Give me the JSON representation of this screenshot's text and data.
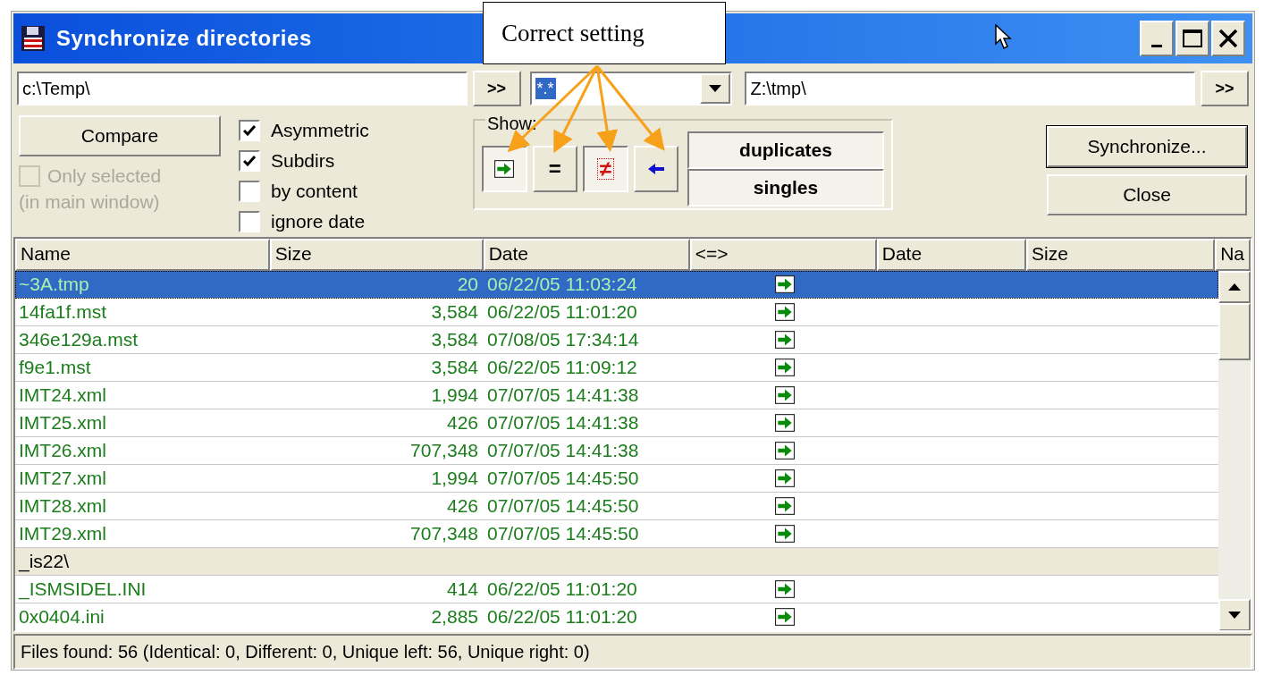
{
  "callout": {
    "text": "Correct setting"
  },
  "window": {
    "title": "Synchronize directories"
  },
  "paths": {
    "left": "c:\\Temp\\",
    "left_button": ">>",
    "filter": "*.*",
    "right": "Z:\\tmp\\",
    "right_button": ">>"
  },
  "compare_button": "Compare",
  "only_selected": {
    "label": "Only selected",
    "note": "(in main window)",
    "checked": false,
    "disabled": true
  },
  "options": [
    {
      "label": "Asymmetric",
      "checked": true
    },
    {
      "label": "Subdirs",
      "checked": true
    },
    {
      "label": "by content",
      "checked": false
    },
    {
      "label": "ignore date",
      "checked": false
    }
  ],
  "show": {
    "label": "Show:",
    "buttons": [
      {
        "kind": "right",
        "selected": true
      },
      {
        "kind": "equal",
        "label": "=",
        "selected": false
      },
      {
        "kind": "different",
        "label": "≠",
        "selected": true
      },
      {
        "kind": "left",
        "selected": false
      }
    ],
    "filters": [
      {
        "label": "duplicates",
        "selected": true
      },
      {
        "label": "singles",
        "selected": true
      }
    ]
  },
  "buttons": [
    "Synchronize...",
    "Close"
  ],
  "table": {
    "columns": [
      "Name",
      "Size",
      "Date",
      "<=>",
      "Date",
      "Size",
      "Na"
    ],
    "rows": [
      {
        "kind": "file",
        "name": "~3A.tmp",
        "size": "20",
        "date": "06/22/05 11:03:24",
        "copy_to_right": true,
        "selected": true
      },
      {
        "kind": "file",
        "name": "14fa1f.mst",
        "size": "3,584",
        "date": "06/22/05 11:01:20",
        "copy_to_right": true,
        "selected": false
      },
      {
        "kind": "file",
        "name": "346e129a.mst",
        "size": "3,584",
        "date": "07/08/05 17:34:14",
        "copy_to_right": true,
        "selected": false
      },
      {
        "kind": "file",
        "name": "f9e1.mst",
        "size": "3,584",
        "date": "06/22/05 11:09:12",
        "copy_to_right": true,
        "selected": false
      },
      {
        "kind": "file",
        "name": "IMT24.xml",
        "size": "1,994",
        "date": "07/07/05 14:41:38",
        "copy_to_right": true,
        "selected": false
      },
      {
        "kind": "file",
        "name": "IMT25.xml",
        "size": "426",
        "date": "07/07/05 14:41:38",
        "copy_to_right": true,
        "selected": false
      },
      {
        "kind": "file",
        "name": "IMT26.xml",
        "size": "707,348",
        "date": "07/07/05 14:41:38",
        "copy_to_right": true,
        "selected": false
      },
      {
        "kind": "file",
        "name": "IMT27.xml",
        "size": "1,994",
        "date": "07/07/05 14:45:50",
        "copy_to_right": true,
        "selected": false
      },
      {
        "kind": "file",
        "name": "IMT28.xml",
        "size": "426",
        "date": "07/07/05 14:45:50",
        "copy_to_right": true,
        "selected": false
      },
      {
        "kind": "file",
        "name": "IMT29.xml",
        "size": "707,348",
        "date": "07/07/05 14:45:50",
        "copy_to_right": true,
        "selected": false
      },
      {
        "kind": "folder",
        "name": "_is22\\",
        "selected": false
      },
      {
        "kind": "file",
        "name": "_ISMSIDEL.INI",
        "size": "414",
        "date": "06/22/05 11:01:20",
        "copy_to_right": true,
        "selected": false
      },
      {
        "kind": "file",
        "name": "0x0404.ini",
        "size": "2,885",
        "date": "06/22/05 11:01:20",
        "copy_to_right": true,
        "selected": false
      }
    ]
  },
  "status_bar": "Files found: 56  (Identical: 0, Different: 0, Unique left: 56, Unique right: 0)"
}
